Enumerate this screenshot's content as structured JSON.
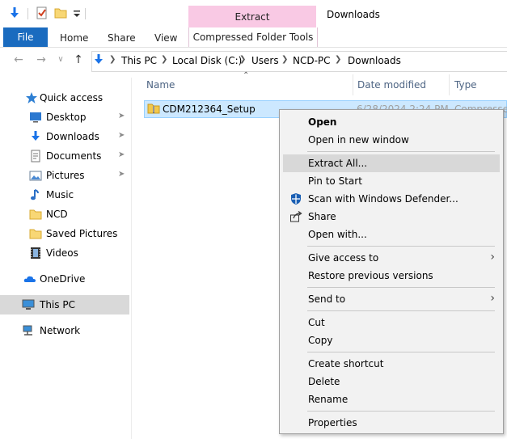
{
  "window": {
    "title": "Downloads"
  },
  "ribbon": {
    "context_tab_header": "Extract",
    "tabs": {
      "file": "File",
      "home": "Home",
      "share": "Share",
      "view": "View",
      "compressed": "Compressed Folder Tools"
    }
  },
  "address": {
    "crumbs": [
      "This PC",
      "Local Disk (C:)",
      "Users",
      "NCD-PC",
      "Downloads"
    ]
  },
  "nav": {
    "quick_access": "Quick access",
    "items": [
      "Desktop",
      "Downloads",
      "Documents",
      "Pictures",
      "Music",
      "NCD",
      "Saved Pictures",
      "Videos"
    ],
    "onedrive": "OneDrive",
    "this_pc": "This PC",
    "network": "Network"
  },
  "columns": {
    "name": "Name",
    "date": "Date modified",
    "type": "Type"
  },
  "file": {
    "name": "CDM212364_Setup",
    "date": "6/28/2024 2:24 PM",
    "type": "Compressed"
  },
  "menu": {
    "open": "Open",
    "open_new_window": "Open in new window",
    "extract_all": "Extract All...",
    "pin_to_start": "Pin to Start",
    "scan": "Scan with Windows Defender...",
    "share": "Share",
    "open_with": "Open with...",
    "give_access": "Give access to",
    "restore": "Restore previous versions",
    "send_to": "Send to",
    "cut": "Cut",
    "copy": "Copy",
    "create_shortcut": "Create shortcut",
    "delete": "Delete",
    "rename": "Rename",
    "properties": "Properties"
  },
  "colors": {
    "accent": "#1a6bbf",
    "context_tab": "#f9c9e4",
    "selection": "#cce8ff",
    "menu_bg": "#f2f2f2",
    "menu_highlight": "#d8d8d8"
  },
  "icons": {
    "quick_toolbar": [
      "download-arrow-icon",
      "properties-check-icon",
      "new-folder-icon",
      "customize-dropdown-icon"
    ],
    "menu": [
      "windows-defender-icon",
      "share-icon"
    ]
  }
}
